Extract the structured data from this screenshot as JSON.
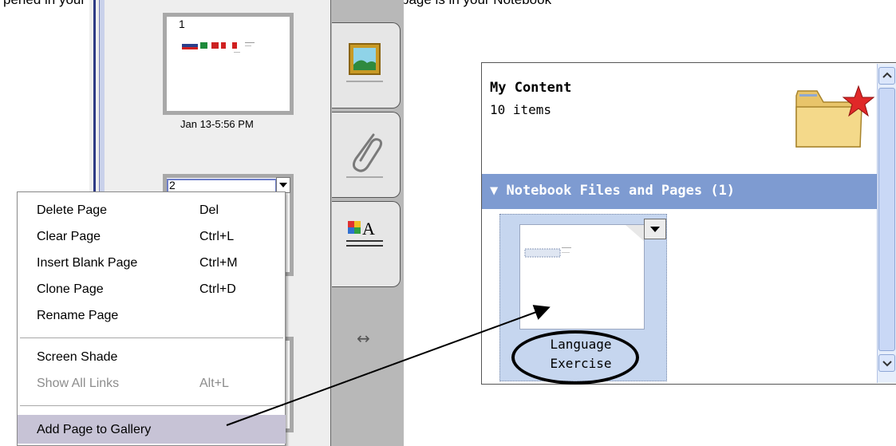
{
  "instruction_text": "pened in your Notebook file and the page that corresponds to that page is in your Notebook",
  "page_sorter": {
    "pages": [
      {
        "number": "1",
        "timestamp": "Jan 13-5:56 PM"
      },
      {
        "number": "2",
        "timestamp": ""
      }
    ]
  },
  "side_tabs": {
    "items": [
      {
        "name": "gallery",
        "icon": "landscape-picture-icon"
      },
      {
        "name": "attachments",
        "icon": "paperclip-icon"
      },
      {
        "name": "properties",
        "icon": "color-text-properties-icon"
      }
    ],
    "resize_glyph": "↔"
  },
  "context_menu": {
    "items": [
      {
        "label": "Delete Page",
        "shortcut": "Del",
        "disabled": false
      },
      {
        "label": "Clear Page",
        "shortcut": "Ctrl+L",
        "disabled": false
      },
      {
        "label": "Insert Blank Page",
        "shortcut": "Ctrl+M",
        "disabled": false
      },
      {
        "label": "Clone Page",
        "shortcut": "Ctrl+D",
        "disabled": false
      },
      {
        "label": "Rename Page",
        "shortcut": "",
        "disabled": false
      },
      {
        "label": "Screen Shade",
        "shortcut": "",
        "disabled": false
      },
      {
        "label": "Show All Links",
        "shortcut": "Alt+L",
        "disabled": true
      },
      {
        "label": "Add Page to Gallery",
        "shortcut": "",
        "disabled": false,
        "highlighted": true
      }
    ]
  },
  "gallery": {
    "header_title": "My Content",
    "header_count": "10 items",
    "section_title": "▼ Notebook Files and Pages (1)",
    "items": [
      {
        "line1": "Language",
        "line2": "Exercise"
      }
    ],
    "colors": {
      "section_bar": "#7e9bd1",
      "selection": "#c6d6ef"
    }
  }
}
